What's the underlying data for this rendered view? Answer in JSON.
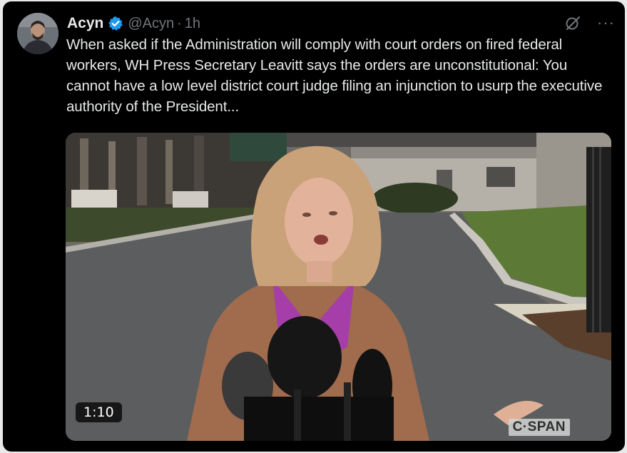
{
  "tweet": {
    "author": {
      "display_name": "Acyn",
      "handle": "@Acyn",
      "separator": "·",
      "time": "1h",
      "avatar_icon": "avatar-photo"
    },
    "verified_icon": "verified-badge-icon",
    "actions": {
      "grok_icon": "grok-icon",
      "more_label": "···"
    },
    "text": "When asked if the Administration will comply with court orders on fired federal workers, WH Press Secretary Leavitt says the orders are unconstitutional: You cannot have a low level district court judge filing an injunction to usurp the executive authority of the President...",
    "media": {
      "type": "video",
      "duration": "1:10",
      "watermark": "C·SPAN"
    }
  },
  "colors": {
    "background": "#000000",
    "text": "#e7e9ea",
    "secondary": "#71767b",
    "verified": "#1d9bf0"
  }
}
